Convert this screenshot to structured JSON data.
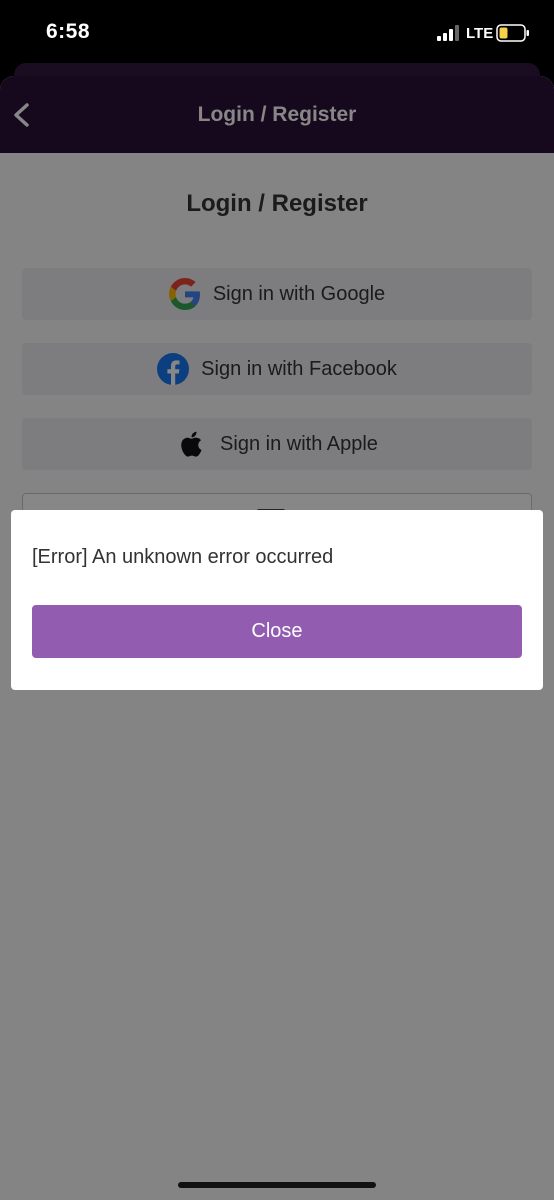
{
  "status_bar": {
    "time": "6:58",
    "network": "LTE",
    "battery_color": "#f5d24a"
  },
  "nav": {
    "title": "Login / Register",
    "back_icon": "chevron-left-icon"
  },
  "page": {
    "title": "Login / Register"
  },
  "buttons": {
    "google": {
      "label": "Sign in with Google",
      "icon": "google-icon"
    },
    "facebook": {
      "label": "Sign in with Facebook",
      "icon": "facebook-icon"
    },
    "apple": {
      "label": "Sign in with Apple",
      "icon": "apple-icon"
    },
    "email": {
      "icon": "mail-icon"
    }
  },
  "dialog": {
    "message": "[Error] An unknown error occurred",
    "close_label": "Close"
  },
  "colors": {
    "nav_bar": "#2a1038",
    "accent": "#925cb0",
    "facebook_blue": "#1877f2"
  }
}
